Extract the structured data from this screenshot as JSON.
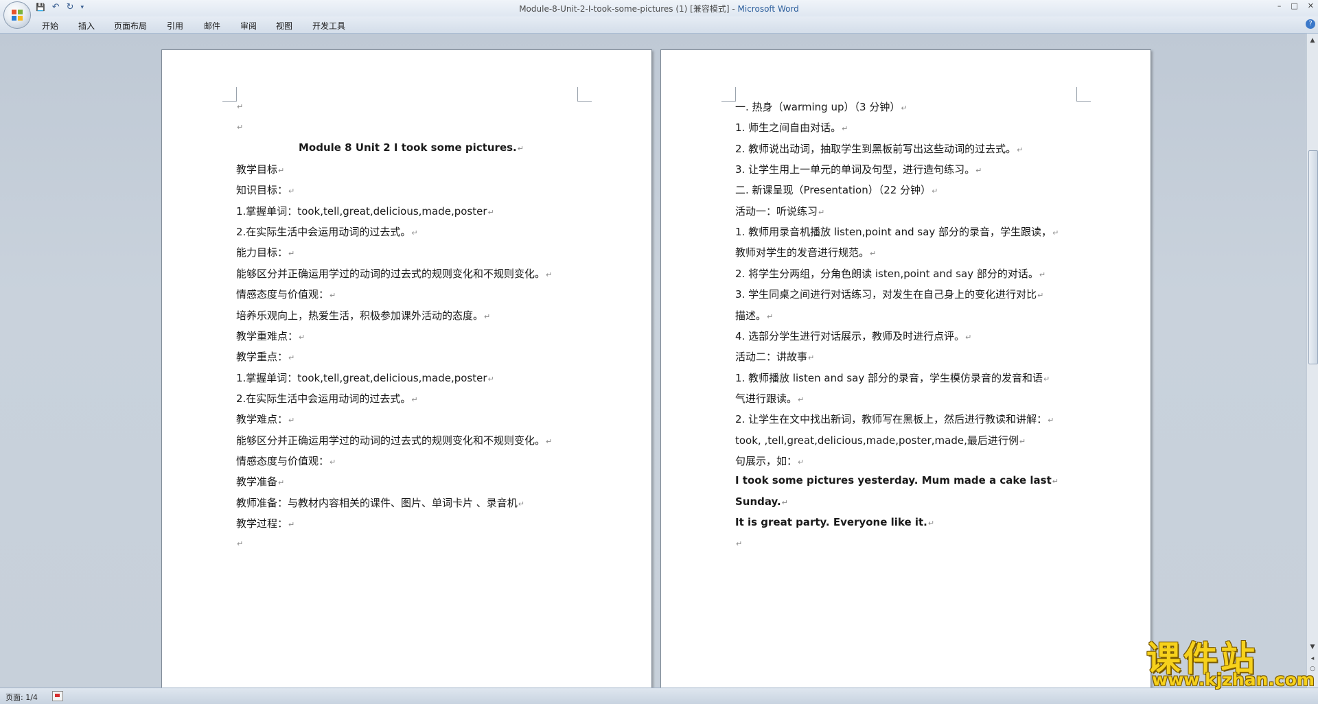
{
  "window": {
    "title": "Module-8-Unit-2-I-took-some-pictures (1) [兼容模式]",
    "title_sep": " - ",
    "app_name": "Microsoft Word",
    "controls": [
      "–",
      "□",
      "✕"
    ]
  },
  "quick_access": {
    "save": "💾",
    "undo": "↶",
    "redo": "↻",
    "more": "▾"
  },
  "ribbon": {
    "tabs": [
      "开始",
      "插入",
      "页面布局",
      "引用",
      "邮件",
      "审阅",
      "视图",
      "开发工具"
    ],
    "help": "?"
  },
  "page1": {
    "lines": [
      {
        "text": "",
        "bold": false
      },
      {
        "text": "",
        "bold": false
      },
      {
        "text": "Module 8 Unit 2 I took some pictures.",
        "bold": true
      },
      {
        "text": "教学目标",
        "bold": false
      },
      {
        "text": "知识目标：",
        "bold": false
      },
      {
        "text": "1.掌握单词：took,tell,great,delicious,made,poster",
        "bold": false
      },
      {
        "text": "2.在实际生活中会运用动词的过去式。",
        "bold": false
      },
      {
        "text": "能力目标：",
        "bold": false
      },
      {
        "text": "能够区分并正确运用学过的动词的过去式的规则变化和不规则变化。",
        "bold": false
      },
      {
        "text": "情感态度与价值观：",
        "bold": false
      },
      {
        "text": "培养乐观向上，热爱生活，积极参加课外活动的态度。",
        "bold": false
      },
      {
        "text": "教学重难点：",
        "bold": false
      },
      {
        "text": "教学重点：",
        "bold": false
      },
      {
        "text": "1.掌握单词：took,tell,great,delicious,made,poster",
        "bold": false
      },
      {
        "text": "2.在实际生活中会运用动词的过去式。",
        "bold": false
      },
      {
        "text": "教学难点：",
        "bold": false
      },
      {
        "text": "能够区分并正确运用学过的动词的过去式的规则变化和不规则变化。",
        "bold": false
      },
      {
        "text": "情感态度与价值观：",
        "bold": false
      },
      {
        "text": "教学准备",
        "bold": false
      },
      {
        "text": "教师准备：与教材内容相关的课件、图片、单词卡片 、录音机",
        "bold": false
      },
      {
        "text": "教学过程：",
        "bold": false
      },
      {
        "text": "",
        "bold": false
      }
    ]
  },
  "page2": {
    "lines": [
      {
        "text": "一.   热身（warming up）（3 分钟）",
        "bold": false
      },
      {
        "text": "1. 师生之间自由对话。",
        "bold": false
      },
      {
        "text": "2. 教师说出动词，抽取学生到黑板前写出这些动词的过去式。",
        "bold": false
      },
      {
        "text": "3. 让学生用上一单元的单词及句型，进行造句练习。",
        "bold": false
      },
      {
        "text": "二.   新课呈现（Presentation）（22 分钟）",
        "bold": false
      },
      {
        "text": "活动一：听说练习",
        "bold": false
      },
      {
        "text": "1. 教师用录音机播放 listen,point and say 部分的录音，学生跟读，",
        "bold": false
      },
      {
        "text": "    教师对学生的发音进行规范。",
        "bold": false
      },
      {
        "text": "2. 将学生分两组，分角色朗读 isten,point and say 部分的对话。",
        "bold": false
      },
      {
        "text": "3. 学生同桌之间进行对话练习，对发生在自己身上的变化进行对比",
        "bold": false
      },
      {
        "text": "    描述。",
        "bold": false
      },
      {
        "text": "4. 选部分学生进行对话展示，教师及时进行点评。",
        "bold": false
      },
      {
        "text": "活动二：讲故事",
        "bold": false
      },
      {
        "text": "  1. 教师播放 listen and say 部分的录音，学生模仿录音的发音和语",
        "bold": false
      },
      {
        "text": "      气进行跟读。",
        "bold": false
      },
      {
        "text": "  2. 让学生在文中找出新词，教师写在黑板上，然后进行教读和讲解：",
        "bold": false
      },
      {
        "text": "      took, ,tell,great,delicious,made,poster,made,最后进行例",
        "bold": false
      },
      {
        "text": "      句展示，如：",
        "bold": false
      },
      {
        "text": "     I took some pictures yesterday. Mum made a cake last",
        "bold": true
      },
      {
        "text": "  Sunday.",
        "bold": true
      },
      {
        "text": "     It is great party.   Everyone like it.",
        "bold": true
      },
      {
        "text": "",
        "bold": false
      }
    ]
  },
  "scrollbar": {
    "up": "▲",
    "down": "▼",
    "prev_page": "◂",
    "browse": "○",
    "next_page": "▸"
  },
  "status": {
    "page_indicator": "页面: 1/4"
  },
  "watermark": {
    "cn": "课件站",
    "url": "www.kjzhan.com"
  },
  "colors": {
    "accent": "#2c5e9c",
    "workspace": "#c5ced9",
    "watermark": "#f6d11c"
  },
  "paragraph_mark": "↵"
}
